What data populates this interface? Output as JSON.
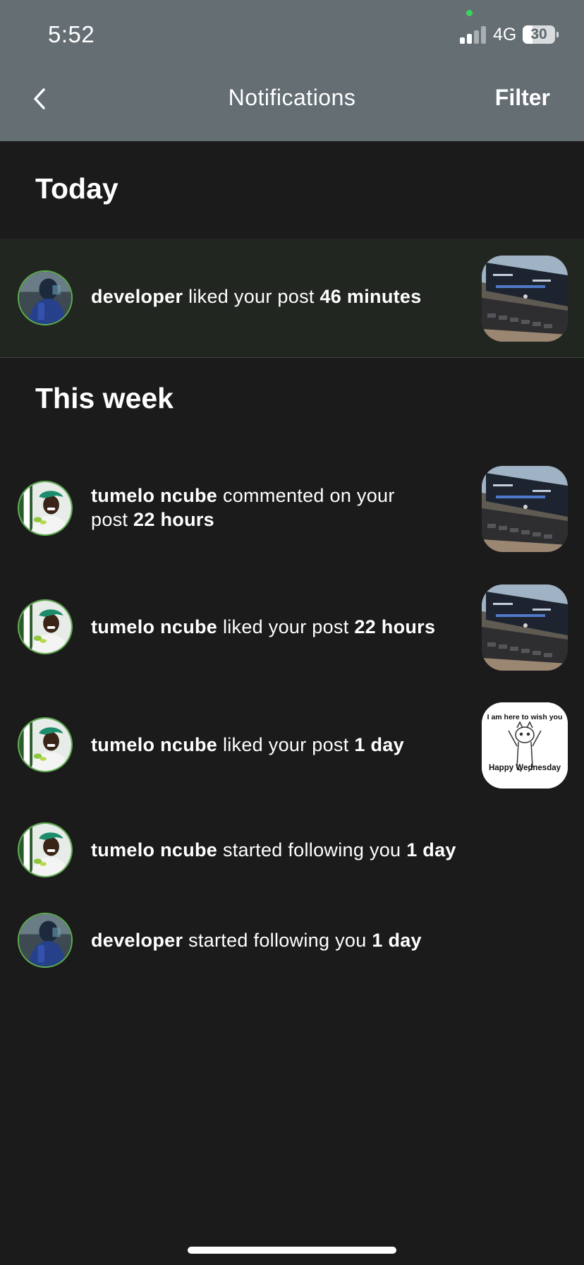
{
  "status_bar": {
    "time": "5:52",
    "network": "4G",
    "battery": "30",
    "battery_level": 0.3
  },
  "header": {
    "title": "Notifications",
    "filter_label": "Filter"
  },
  "sections": {
    "today": "Today",
    "this_week": "This week"
  },
  "notifications": [
    {
      "user": "developer",
      "action": "liked your post",
      "time": "46 minutes",
      "thumbnail": "laptop-photo",
      "avatar": "developer-avatar"
    },
    {
      "user": "tumelo ncube",
      "action": "commented on your",
      "action2": "post",
      "time": "22 hours",
      "thumbnail": "laptop-photo",
      "avatar": "tumelo-avatar"
    },
    {
      "user": "tumelo ncube",
      "action": "liked your post",
      "time": "22 hours",
      "thumbnail": "laptop-photo",
      "avatar": "tumelo-avatar"
    },
    {
      "user": "tumelo ncube",
      "action": "liked your post",
      "time": "1 day",
      "thumbnail": "meme-image",
      "avatar": "tumelo-avatar",
      "meme_top": "I am here to wish you",
      "meme_bottom": "Happy Wednesday"
    },
    {
      "user": "tumelo ncube",
      "action": "started following you",
      "time": "1 day",
      "avatar": "tumelo-avatar"
    },
    {
      "user": "developer",
      "action": "started following you",
      "time": "1 day",
      "avatar": "developer-avatar"
    }
  ],
  "colors": {
    "header_bg": "#646e73",
    "page_bg": "#1b1b1c",
    "highlight_bg": "#212621",
    "avatar_ring": "#5fae4f"
  }
}
